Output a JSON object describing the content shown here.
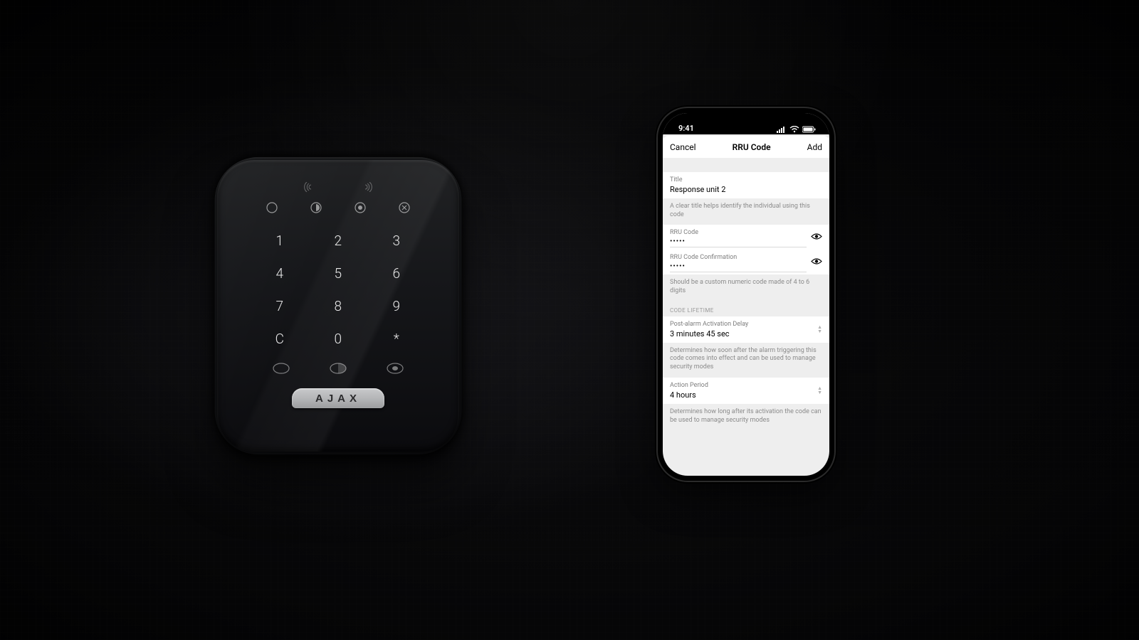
{
  "status_bar": {
    "time": "9:41"
  },
  "sheet": {
    "cancel": "Cancel",
    "title": "RRU Code",
    "add": "Add"
  },
  "title_field": {
    "label": "Title",
    "value": "Response unit 2",
    "helper": "A clear title helps identify the individual using this code"
  },
  "code_field": {
    "label": "RRU Code",
    "value": "•••••"
  },
  "code_confirm_field": {
    "label": "RRU Code Confirmation",
    "value": "•••••",
    "helper": "Should be a custom numeric code made of 4 to 6 digits"
  },
  "lifetime_section": {
    "header": "CODE LIFETIME",
    "activation_delay": {
      "label": "Post-alarm Activation Delay",
      "value": "3 minutes 45 sec",
      "helper": "Determines how soon after the alarm triggering this code comes into effect and can be used to manage security modes"
    },
    "action_period": {
      "label": "Action Period",
      "value": "4 hours",
      "helper": "Determines how long after its activation the code can be used to manage security modes"
    }
  },
  "keypad": {
    "brand": "AJAX",
    "keys": [
      "1",
      "2",
      "3",
      "4",
      "5",
      "6",
      "7",
      "8",
      "9",
      "C",
      "0",
      "*"
    ]
  }
}
